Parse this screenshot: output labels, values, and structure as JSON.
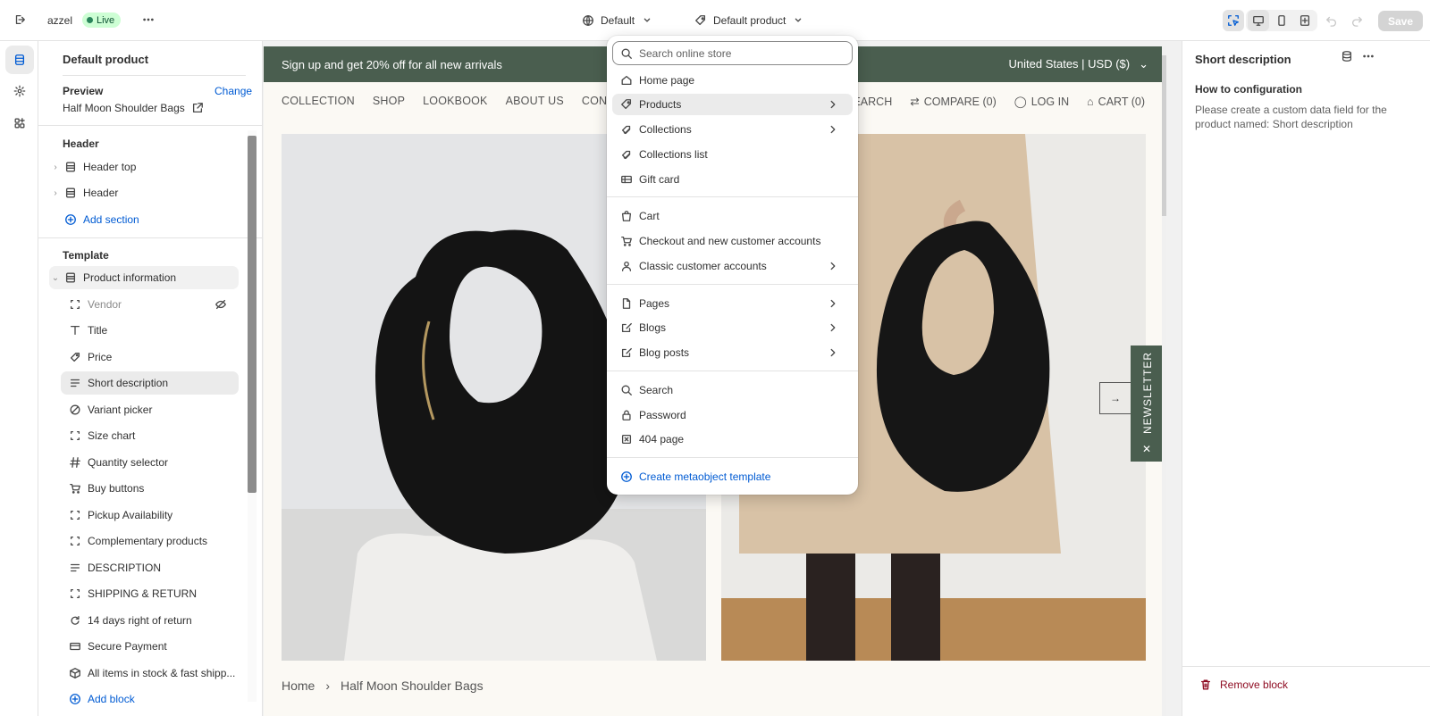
{
  "topbar": {
    "store_name": "azzel",
    "live_label": "Live",
    "theme_label": "Default",
    "template_label": "Default product",
    "save_label": "Save"
  },
  "left_panel": {
    "title": "Default product",
    "preview_label": "Preview",
    "change_label": "Change",
    "preview_product": "Half Moon Shoulder Bags",
    "header_heading": "Header",
    "header_items": [
      {
        "label": "Header top",
        "icon": "section-icon"
      },
      {
        "label": "Header",
        "icon": "section-icon"
      }
    ],
    "add_section_label": "Add section",
    "template_heading": "Template",
    "product_info_label": "Product information",
    "blocks": [
      {
        "label": "Vendor",
        "icon": "block-frame-icon"
      },
      {
        "label": "Title",
        "icon": "text-icon"
      },
      {
        "label": "Price",
        "icon": "price-tag-icon"
      },
      {
        "label": "Short description",
        "icon": "text-lines-icon"
      },
      {
        "label": "Variant picker",
        "icon": "variant-icon"
      },
      {
        "label": "Size chart",
        "icon": "block-frame-icon"
      },
      {
        "label": "Quantity selector",
        "icon": "hash-icon"
      },
      {
        "label": "Buy buttons",
        "icon": "cart-icon"
      },
      {
        "label": "Pickup Availability",
        "icon": "block-frame-icon"
      },
      {
        "label": "Complementary products",
        "icon": "block-frame-icon"
      },
      {
        "label": "DESCRIPTION",
        "icon": "text-lines-icon"
      },
      {
        "label": "SHIPPING & RETURN",
        "icon": "block-frame-icon"
      },
      {
        "label": "14 days right of return",
        "icon": "refresh-icon"
      },
      {
        "label": "Secure Payment",
        "icon": "card-icon"
      },
      {
        "label": "All items in stock & fast shipp...",
        "icon": "box-icon"
      }
    ],
    "add_block_label": "Add block"
  },
  "preview": {
    "announcement": "Sign up and get 20% off for all new arrivals",
    "country_currency": "United States | USD ($)",
    "nav_left": [
      "COLLECTION",
      "SHOP",
      "LOOKBOOK",
      "ABOUT US",
      "CONTACT US"
    ],
    "nav_right": [
      "SEARCH",
      "COMPARE (0)",
      "LOG IN",
      "CART (0)"
    ],
    "breadcrumb_home": "Home",
    "breadcrumb_product": "Half Moon Shoulder Bags",
    "newsletter_label": "NEWSLETTER"
  },
  "dropdown": {
    "search_placeholder": "Search online store",
    "groups": [
      [
        {
          "label": "Home page",
          "icon": "home-icon",
          "submenu": false
        },
        {
          "label": "Products",
          "icon": "tag-icon",
          "submenu": true,
          "selected": true
        },
        {
          "label": "Collections",
          "icon": "collection-icon",
          "submenu": true
        },
        {
          "label": "Collections list",
          "icon": "collection-icon",
          "submenu": false
        },
        {
          "label": "Gift card",
          "icon": "gift-card-icon",
          "submenu": false
        }
      ],
      [
        {
          "label": "Cart",
          "icon": "bag-icon",
          "submenu": false
        },
        {
          "label": "Checkout and new customer accounts",
          "icon": "cart-icon",
          "submenu": false
        },
        {
          "label": "Classic customer accounts",
          "icon": "person-icon",
          "submenu": true
        }
      ],
      [
        {
          "label": "Pages",
          "icon": "page-icon",
          "submenu": true
        },
        {
          "label": "Blogs",
          "icon": "blog-icon",
          "submenu": true
        },
        {
          "label": "Blog posts",
          "icon": "blog-icon",
          "submenu": true
        }
      ],
      [
        {
          "label": "Search",
          "icon": "search-icon",
          "submenu": false
        },
        {
          "label": "Password",
          "icon": "lock-icon",
          "submenu": false
        },
        {
          "label": "404 page",
          "icon": "error-page-icon",
          "submenu": false
        }
      ]
    ],
    "create_label": "Create metaobject template"
  },
  "right_panel": {
    "title": "Short description",
    "how_heading": "How to configuration",
    "how_text": "Please create a custom data field for the product named: Short description",
    "remove_label": "Remove block"
  },
  "colors": {
    "accent": "#005bd3",
    "announcement_bg": "#4a5e4f",
    "live_badge_bg": "#cdfed4",
    "danger": "#8e0b21"
  }
}
